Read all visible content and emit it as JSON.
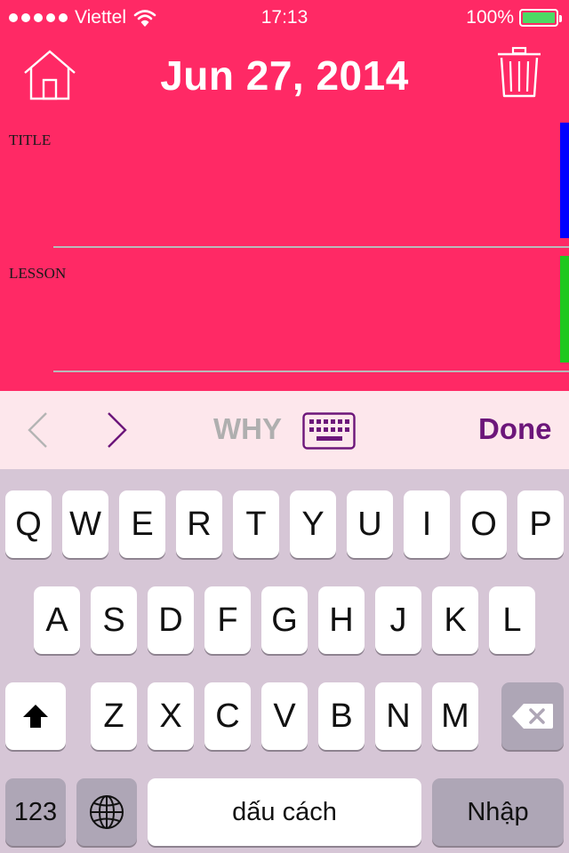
{
  "status_bar": {
    "carrier": "Viettel",
    "time": "17:13",
    "battery_text": "100%",
    "battery_level": 1.0,
    "signal_bars": 5
  },
  "header": {
    "title": "Jun 27, 2014",
    "home_icon": "home-icon",
    "trash_icon": "trash-icon"
  },
  "fields": [
    {
      "label": "TITLE",
      "value": "",
      "side_color": "#0000FF"
    },
    {
      "label": "LESSON",
      "value": "",
      "side_color": "#1EC81E"
    }
  ],
  "toolbar": {
    "prev_icon": "chevron-left-icon",
    "next_icon": "chevron-right-icon",
    "why_label": "WHY",
    "keyboard_icon": "keyboard-icon",
    "done_label": "Done"
  },
  "keyboard": {
    "row1": [
      "Q",
      "W",
      "E",
      "R",
      "T",
      "Y",
      "U",
      "I",
      "O",
      "P"
    ],
    "row2": [
      "A",
      "S",
      "D",
      "F",
      "G",
      "H",
      "J",
      "K",
      "L"
    ],
    "row3": [
      "Z",
      "X",
      "C",
      "V",
      "B",
      "N",
      "M"
    ],
    "shift_icon": "shift-icon",
    "delete_icon": "delete-icon",
    "numbers_label": "123",
    "globe_icon": "globe-icon",
    "space_label": "dấu cách",
    "return_label": "Nhập"
  },
  "colors": {
    "header_bg": "#FF2965",
    "toolbar_bg": "#FDE7EC",
    "accent": "#6C167A",
    "keyboard_bg": "#D6C6D6"
  }
}
